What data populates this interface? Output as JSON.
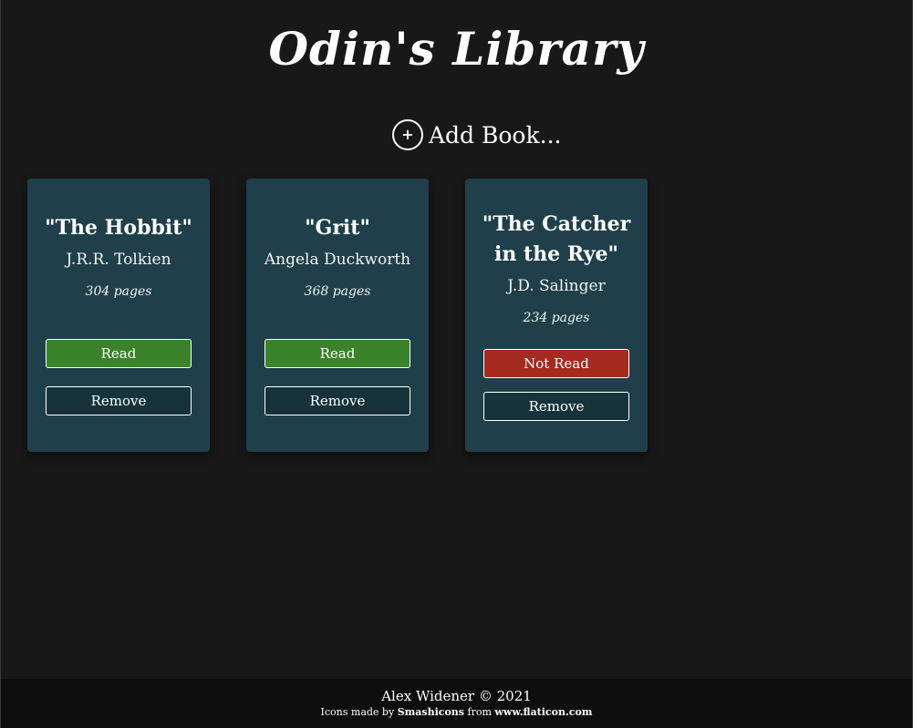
{
  "header": {
    "title": "Odin's Library",
    "add_book_icon": "+",
    "add_book_label": "Add Book..."
  },
  "books": [
    {
      "title": "\"The Hobbit\"",
      "author": "J.R.R. Tolkien",
      "pages": "304 pages",
      "status_label": "Read",
      "status": "read",
      "remove_label": "Remove"
    },
    {
      "title": "\"Grit\"",
      "author": "Angela Duckworth",
      "pages": "368 pages",
      "status_label": "Read",
      "status": "read",
      "remove_label": "Remove"
    },
    {
      "title": "\"The Catcher in the Rye\"",
      "author": "J.D. Salinger",
      "pages": "234 pages",
      "status_label": "Not Read",
      "status": "not-read",
      "remove_label": "Remove"
    }
  ],
  "footer": {
    "credit": "Alex Widener © 2021",
    "icons_prefix": "Icons made by ",
    "icons_author": "Smashicons",
    "icons_middle": " from ",
    "icons_site": "www.flaticon.com"
  },
  "colors": {
    "background": "#181818",
    "card": "#1f404a",
    "read": "#3a832a",
    "not_read": "#a52a1f",
    "remove": "#16333b",
    "footer": "#0e0e0e"
  }
}
